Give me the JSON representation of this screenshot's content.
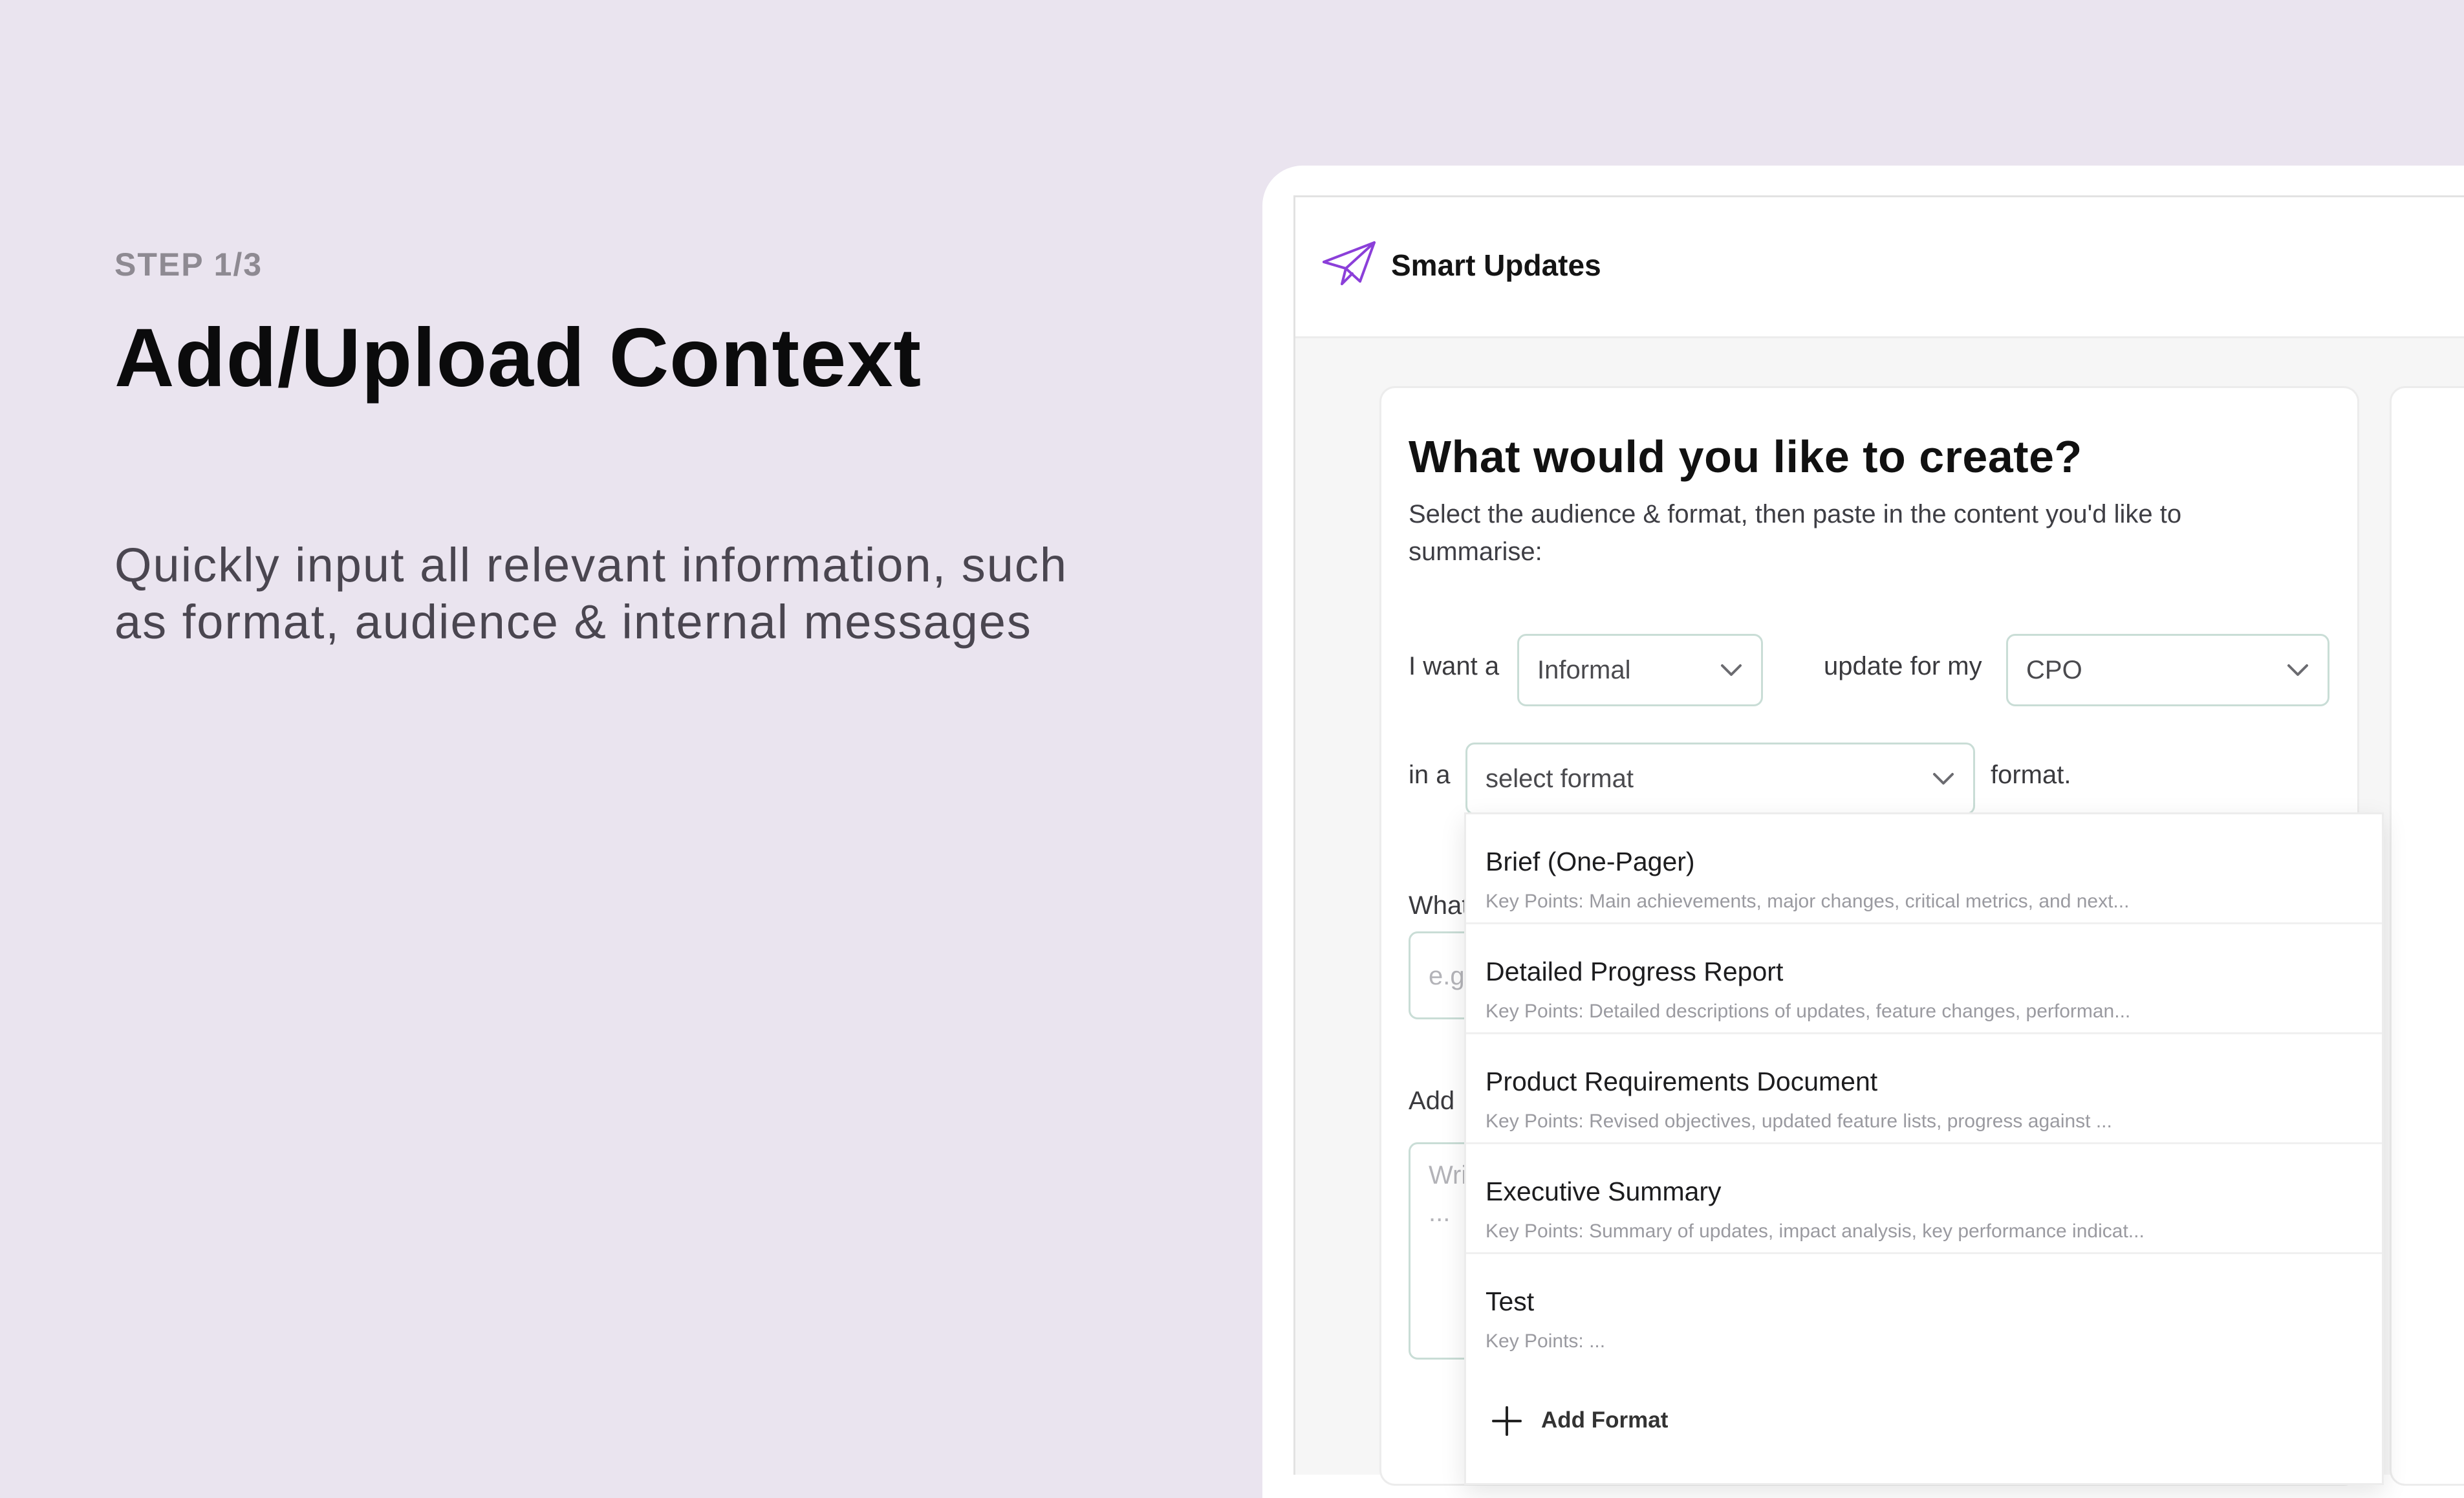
{
  "hero": {
    "step": "STEP 1/3",
    "headline": "Add/Upload Context",
    "subtext": "Quickly input all relevant information, such as format, audience & internal messages"
  },
  "app": {
    "title": "Smart Updates",
    "logo_icon": "paper-plane-icon",
    "accent_color": "#8b3fd9"
  },
  "form": {
    "title": "What would you like to create?",
    "subtitle": "Select the audience & format, then paste in the content you'd like to summarise:",
    "sentence": {
      "part1": "I want a",
      "tone_value": "Informal",
      "part2": "update for my",
      "audience_value": "CPO",
      "part3": "in a",
      "format_placeholder": "select format",
      "part4": "format."
    },
    "partial_label_1": "What",
    "partial_placeholder_1": "e.g",
    "partial_label_2": "Add",
    "partial_placeholder_2": "Wri",
    "partial_placeholder_2b": "..."
  },
  "format_dropdown": {
    "options": [
      {
        "title": "Brief (One-Pager)",
        "desc": "Key Points: Main achievements, major changes, critical metrics, and next..."
      },
      {
        "title": "Detailed Progress Report",
        "desc": "Key Points: Detailed descriptions of updates, feature changes, performan..."
      },
      {
        "title": "Product Requirements Document",
        "desc": "Key Points: Revised objectives, updated feature lists, progress against ..."
      },
      {
        "title": "Executive Summary",
        "desc": "Key Points: Summary of updates, impact analysis, key performance indicat..."
      },
      {
        "title": "Test",
        "desc": "Key Points: ..."
      }
    ],
    "add_label": "Add Format",
    "add_icon": "plus-icon"
  },
  "colors": {
    "background": "#eae4ef",
    "input_border": "#c9ddd6"
  }
}
